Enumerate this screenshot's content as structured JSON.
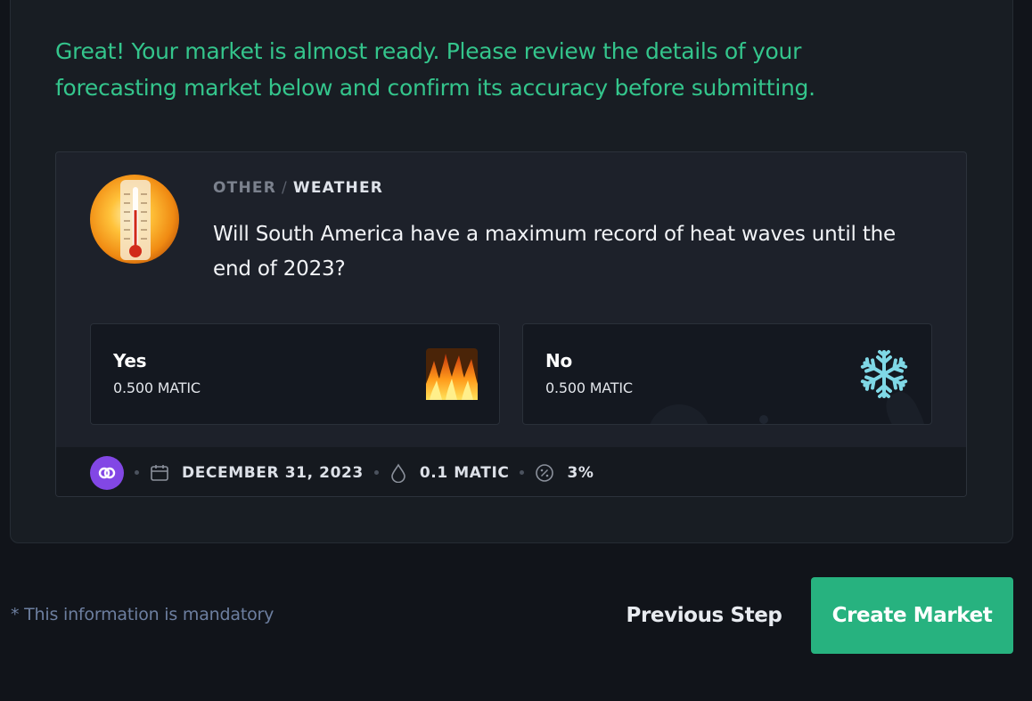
{
  "intro": {
    "text": "Great! Your market is almost ready. Please review the details of your forecasting market below and confirm its accuracy before submitting."
  },
  "market": {
    "image_icon": "thermometer-heat-image",
    "category": {
      "parent": "OTHER",
      "separator": "/",
      "child": "WEATHER"
    },
    "question": "Will South America have a maximum record of heat waves until the end of 2023?",
    "options": [
      {
        "label": "Yes",
        "price": "0.500 MATIC",
        "icon": "fire-icon"
      },
      {
        "label": "No",
        "price": "0.500 MATIC",
        "icon": "snowflake-icon"
      }
    ],
    "meta": {
      "chain_icon": "polygon-icon",
      "end_date": "DECEMBER 31, 2023",
      "liquidity": "0.1 MATIC",
      "fee": "3%"
    }
  },
  "footer": {
    "mandatory_note": "* This information is mandatory",
    "previous_label": "Previous Step",
    "create_label": "Create Market"
  },
  "colors": {
    "accent": "#27b27f",
    "intro_text": "#34c58c",
    "polygon": "#8247e5",
    "background": "#11141a",
    "panel": "#181d23"
  }
}
